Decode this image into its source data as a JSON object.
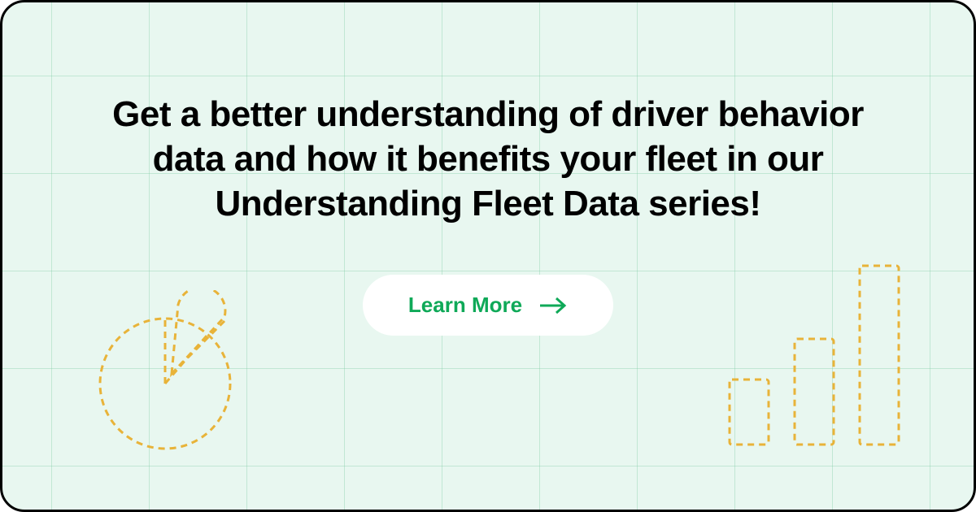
{
  "headline": "Get a better understanding of driver behavior data and how it benefits your fleet in our Understanding Fleet Data series!",
  "cta": {
    "label": "Learn More"
  },
  "colors": {
    "background": "#e8f7f0",
    "accent": "#0fa958",
    "decoration": "#e8b339"
  }
}
